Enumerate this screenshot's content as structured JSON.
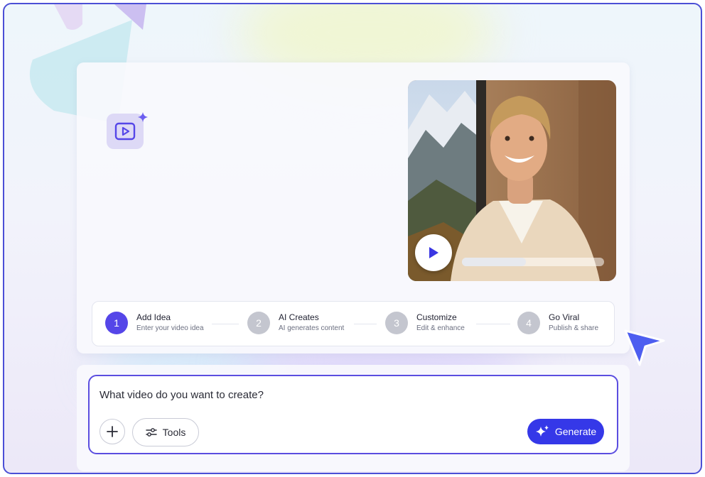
{
  "steps": [
    {
      "number": "1",
      "title": "Add Idea",
      "subtitle": "Enter your video idea",
      "active": true
    },
    {
      "number": "2",
      "title": "AI Creates",
      "subtitle": "AI generates content",
      "active": false
    },
    {
      "number": "3",
      "title": "Customize",
      "subtitle": "Edit & enhance",
      "active": false
    },
    {
      "number": "4",
      "title": "Go Viral",
      "subtitle": "Publish & share",
      "active": false
    }
  ],
  "video": {
    "progress": 0.45
  },
  "composer": {
    "prompt": "What video do you want to create?",
    "tools_label": "Tools",
    "generate_label": "Generate"
  },
  "icons": {
    "app": "video-play-icon",
    "sparkle": "sparkle-icon",
    "play": "play-icon",
    "add": "plus-icon",
    "tools": "sliders-icon",
    "generate": "sparkles-icon",
    "cursor": "pointer-cursor-icon"
  },
  "colors": {
    "accent": "#5546e8",
    "generate": "#3538e8",
    "border": "#5b4ee0"
  }
}
